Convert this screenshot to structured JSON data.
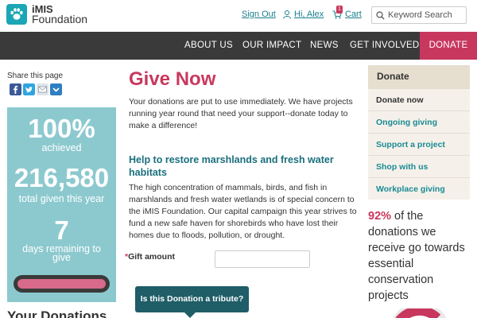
{
  "header": {
    "logo_line1": "iMIS",
    "logo_line2": "Foundation",
    "sign_out": "Sign Out",
    "greeting": "Hi, Alex",
    "cart_label": "Cart",
    "cart_count": "1",
    "search_placeholder": "Keyword Search"
  },
  "nav": {
    "about": "ABOUT US",
    "impact": "OUR IMPACT",
    "news": "NEWS",
    "involved": "GET INVOLVED",
    "donate": "DONATE"
  },
  "share": {
    "label": "Share this page",
    "icons": [
      "facebook-icon",
      "twitter-icon",
      "email-icon",
      "more-icon"
    ]
  },
  "campaign": {
    "percent": "100%",
    "percent_label": "achieved",
    "total": "216,580",
    "total_label": "total given this year",
    "days": "7",
    "days_label": "days remaining to give",
    "progress": 1.0
  },
  "main": {
    "title": "Give Now",
    "intro": "Your donations are put to use immediately. We have projects running year round that need your support--donate today to make a difference!",
    "heading": "Help to restore marshlands and fresh water habitats",
    "body": "The high concentration of mammals, birds, and fish in marshlands and fresh water wetlands is of special concern to the iMIS Foundation. Our capital campaign this year strives to fund a new safe haven for shorebirds who have lost their homes due to floods, pollution, or drought.",
    "required_mark": "*",
    "gift_label": "Gift amount",
    "gift_value": "",
    "tribute": "Is this Donation a tribute?"
  },
  "left": {
    "your_donations": "Your Donations"
  },
  "sidebar": {
    "title": "Donate",
    "items": [
      {
        "label": "Donate now",
        "active": true
      },
      {
        "label": "Ongoing giving",
        "active": false
      },
      {
        "label": "Support a project",
        "active": false
      },
      {
        "label": "Shop with us",
        "active": false
      },
      {
        "label": "Workplace giving",
        "active": false
      }
    ],
    "pct": "92%",
    "pct_text": " of the donations we receive go towards essential conservation projects"
  },
  "colors": {
    "accent": "#c8385e",
    "teal": "#1aa6b5",
    "panel": "#8cc9cf",
    "nav": "#3a3a3a"
  }
}
